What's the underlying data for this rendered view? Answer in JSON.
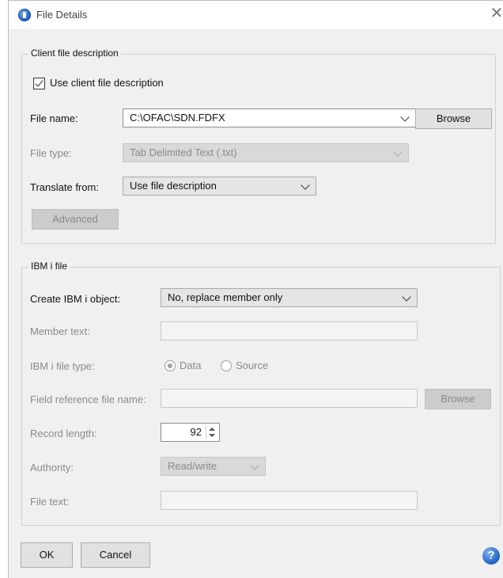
{
  "window": {
    "title": "File Details"
  },
  "client": {
    "legend": "Client file description",
    "use_desc_label": "Use client file description",
    "file_name_label": "File name:",
    "file_name_value": "C:\\OFAC\\SDN.FDFX",
    "browse_label": "Browse",
    "file_type_label": "File type:",
    "file_type_value": "Tab Delimited Text (.txt)",
    "translate_label": "Translate from:",
    "translate_value": "Use file description",
    "advanced_label": "Advanced"
  },
  "ibm": {
    "legend": "IBM i file",
    "create_label": "Create IBM i object:",
    "create_value": "No, replace member only",
    "member_text_label": "Member text:",
    "member_text_value": "",
    "file_type_label": "IBM i file type:",
    "radio_data": "Data",
    "radio_source": "Source",
    "field_ref_label": "Field reference file name:",
    "field_ref_value": "",
    "browse_label": "Browse",
    "record_length_label": "Record length:",
    "record_length_value": "92",
    "authority_label": "Authority:",
    "authority_value": "Read/write",
    "file_text_label": "File text:",
    "file_text_value": ""
  },
  "footer": {
    "ok_label": "OK",
    "cancel_label": "Cancel"
  },
  "icons": {
    "app": "info-app-icon",
    "close": "close-icon",
    "help": "help-icon"
  }
}
